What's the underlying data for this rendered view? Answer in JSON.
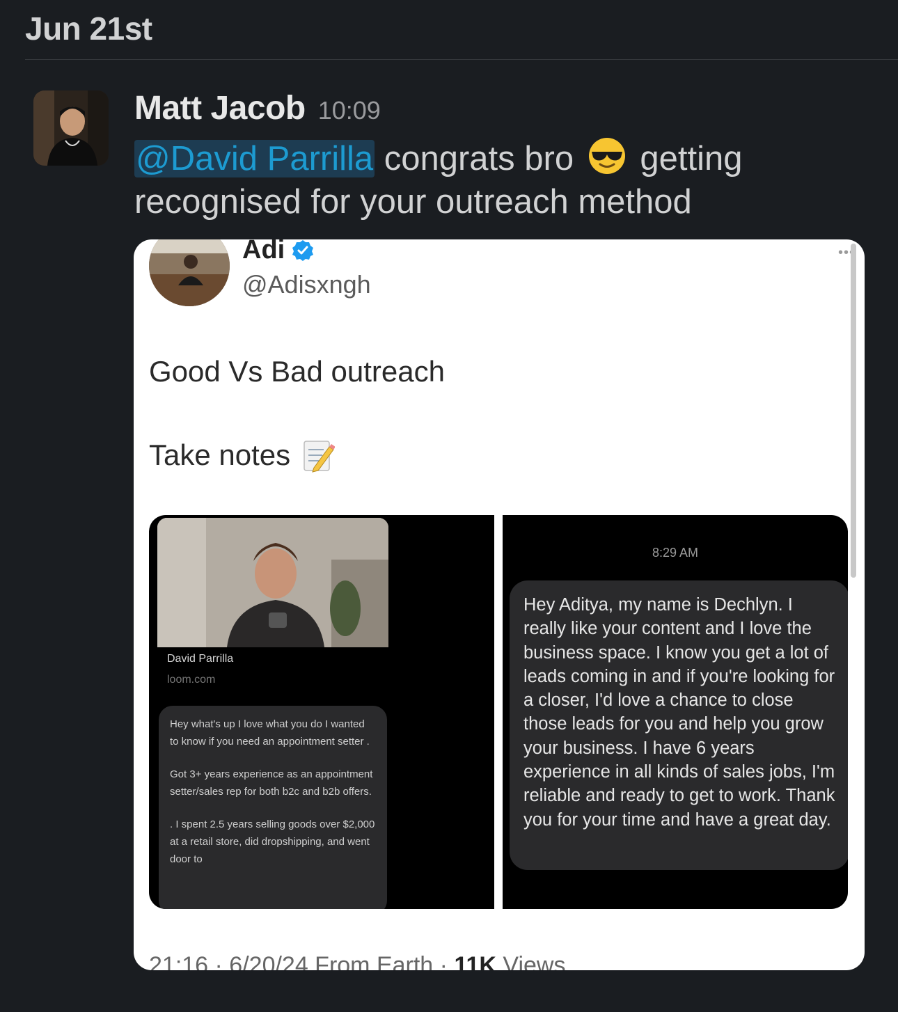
{
  "date_header": "Jun 21st",
  "message": {
    "sender": "Matt Jacob",
    "time": "10:09",
    "mention": "@David Parrilla",
    "text_before_emoji": " congrats bro ",
    "emoji": "sunglasses-emoji",
    "text_after_emoji": " getting recognised for your outreach method"
  },
  "tweet": {
    "name": "Adi",
    "handle": "@Adisxngh",
    "line1": "Good Vs Bad outreach",
    "line2": "Take notes",
    "line2_icon": "memo-icon",
    "left_panel": {
      "link_title": "David Parrilla",
      "link_domain": "loom.com",
      "paragraphs": [
        "Hey what's up I love what you do I wanted to know if you need an appointment setter .",
        "Got 3+ years experience as an appointment setter/sales rep for both b2c and b2b offers.",
        ". I spent 2.5 years selling goods over $2,000 at a retail store, did dropshipping, and went door to"
      ]
    },
    "right_panel": {
      "time": "8:29 AM",
      "message": "Hey Aditya, my name is Dechlyn. I really like your content and I love the business space. I know you get a lot of leads coming in and if you're looking for a closer, I'd love a chance to close those leads for you and help you grow your business. I have 6 years experience in all kinds of sales jobs, I'm reliable and ready to get to work. Thank you for your time and have a great day."
    },
    "footer_meta": "21:16 · 6/20/24 From Earth · ",
    "footer_views_count": "11K",
    "footer_views_label": " Views"
  },
  "colors": {
    "background": "#1a1d21",
    "mention_bg": "#1d3c52",
    "mention_text": "#1d9bd1",
    "verified": "#1d9bf0"
  }
}
